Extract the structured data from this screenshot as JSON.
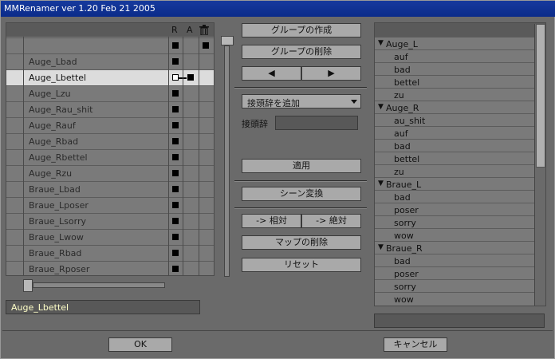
{
  "window": {
    "title": "MMRenamer ver 1.20 Feb 21 2005"
  },
  "list": {
    "headers": {
      "r": "R",
      "a": "A",
      "trash_icon": "trash-icon"
    },
    "rows": [
      {
        "label": ""
      },
      {
        "label": "Auge_Lbad"
      },
      {
        "label": "Auge_Lbettel"
      },
      {
        "label": "Auge_Lzu"
      },
      {
        "label": "Auge_Rau_shit"
      },
      {
        "label": "Auge_Rauf"
      },
      {
        "label": "Auge_Rbad"
      },
      {
        "label": "Auge_Rbettel"
      },
      {
        "label": "Auge_Rzu"
      },
      {
        "label": "Braue_Lbad"
      },
      {
        "label": "Braue_Lposer"
      },
      {
        "label": "Braue_Lsorry"
      },
      {
        "label": "Braue_Lwow"
      },
      {
        "label": "Braue_Rbad"
      },
      {
        "label": "Braue_Rposer"
      }
    ],
    "selected": "Auge_Lbettel"
  },
  "name_field": {
    "value": "Auge_Lbettel"
  },
  "buttons": {
    "create_group": "グループの作成",
    "delete_group": "グループの削除",
    "prev": "◀",
    "next": "▶",
    "apply": "適用",
    "scene_convert": "シーン変換",
    "to_relative": "-> 相対",
    "to_absolute": "-> 絶対",
    "delete_map": "マップの削除",
    "reset": "リセット",
    "ok": "OK",
    "cancel": "キャンセル"
  },
  "prefix": {
    "dropdown_value": "接頭辞を追加",
    "label": "接頭辞",
    "value": ""
  },
  "tree": [
    {
      "group": "Auge_L",
      "items": [
        "auf",
        "bad",
        "bettel",
        "zu"
      ]
    },
    {
      "group": "Auge_R",
      "items": [
        "au_shit",
        "auf",
        "bad",
        "bettel",
        "zu"
      ]
    },
    {
      "group": "Braue_L",
      "items": [
        "bad",
        "poser",
        "sorry",
        "wow"
      ]
    },
    {
      "group": "Braue_R",
      "items": [
        "bad",
        "poser",
        "sorry",
        "wow"
      ]
    }
  ],
  "status_field": {
    "value": ""
  }
}
